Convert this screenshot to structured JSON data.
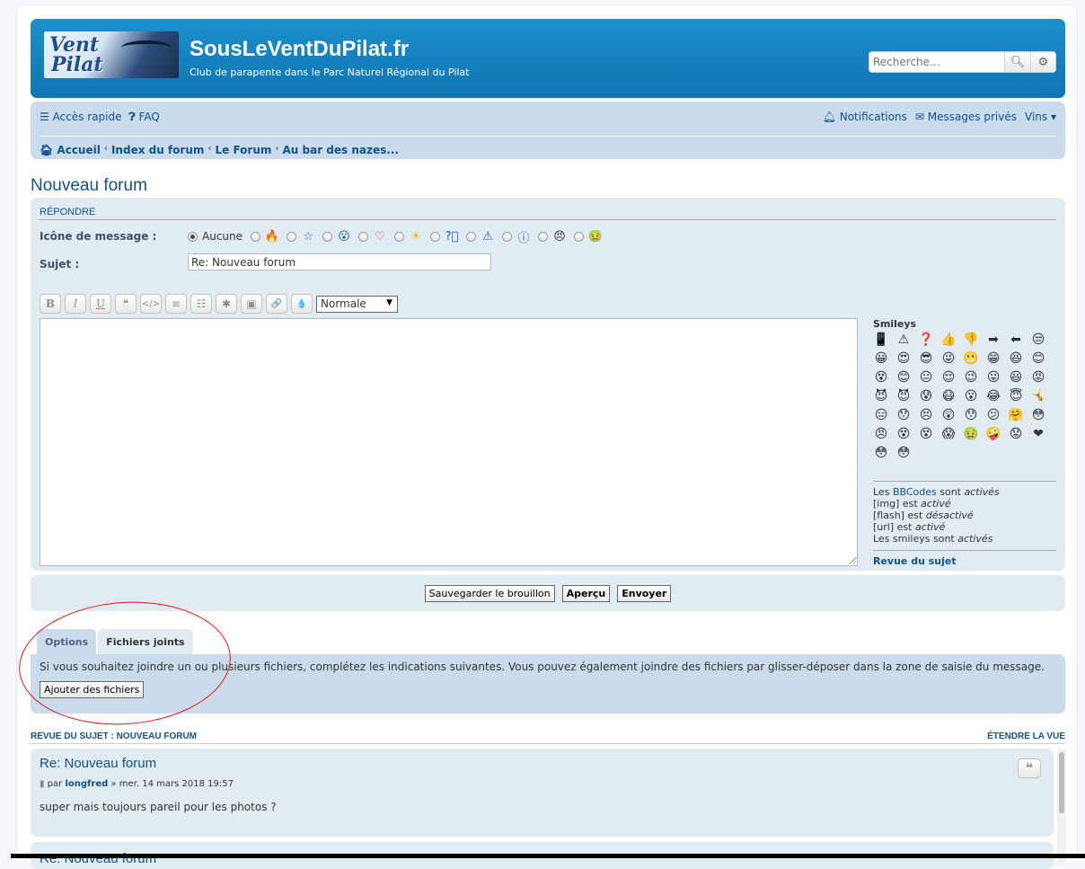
{
  "header": {
    "logo_text_line1": "Vent",
    "logo_text_line2": "Pilat",
    "site_title": "SousLeVentDuPilat.fr",
    "site_description": "Club de parapente dans le Parc Naturel Régional du Pilat",
    "search_placeholder": "Recherche…"
  },
  "navbar": {
    "quick_access": "Accès rapide",
    "faq": "FAQ",
    "notifications": "Notifications",
    "private_messages": "Messages privés",
    "user": "Vins",
    "breadcrumbs": [
      "Accueil",
      "Index du forum",
      "Le Forum",
      "Au bar des nazes..."
    ]
  },
  "page_title": "Nouveau forum",
  "post_form": {
    "heading": "Répondre",
    "icon_label": "Icône de message :",
    "icon_none": "Aucune",
    "icons": [
      "flame-icon",
      "star-icon",
      "surprised-icon",
      "heart-icon",
      "sun-icon",
      "question-icon",
      "warning-icon",
      "info-icon",
      "orange-face-icon",
      "green-face-icon"
    ],
    "subject_label": "Sujet :",
    "subject_value": "Re: Nouveau forum",
    "toolbar": [
      "B",
      "I",
      "U",
      "❝",
      "</>",
      "≡",
      "☷",
      "✱",
      "▣",
      "🔗",
      "💧"
    ],
    "font_size": "Normale",
    "smileys_title": "Smileys",
    "smileys": [
      "📱",
      "⚠",
      "❓",
      "👍",
      "👎",
      "➡",
      "⬅",
      "😒",
      "😀",
      "😍",
      "😎",
      "😜",
      "😬",
      "😁",
      "😆",
      "😊",
      "😵",
      "😊",
      "😐",
      "😌",
      "😉",
      "😛",
      "😃",
      "😡",
      "😈",
      "😈",
      "😰",
      "😷",
      "😮",
      "😂",
      "😇",
      "🤸",
      "😑",
      "😯",
      "😣",
      "😲",
      "😯",
      "😕",
      "🤗",
      "😳",
      "😠",
      "😵",
      "😵",
      "😱",
      "🤢",
      "🤪",
      "😟",
      "❤",
      "😳",
      "😳"
    ],
    "info": {
      "bbcodes_prefix": "Les",
      "bbcodes_link": "BBCodes",
      "bbcodes_suffix": "sont",
      "bbcodes_state": "activés",
      "img_label": "[img] est",
      "img_state": "activé",
      "flash_label": "[flash] est",
      "flash_state": "désactivé",
      "url_label": "[url] est",
      "url_state": "activé",
      "smileys_label": "Les smileys sont",
      "smileys_state": "activés"
    },
    "review_link": "Revue du sujet"
  },
  "submit": {
    "save_draft": "Sauvegarder le brouillon",
    "preview": "Aperçu",
    "send": "Envoyer"
  },
  "tabs": {
    "options": "Options",
    "attachments": "Fichiers joints"
  },
  "attachments": {
    "text": "Si vous souhaitez joindre un ou plusieurs fichiers, complétez les indications suivantes. Vous pouvez également joindre des fichiers par glisser-déposer dans la zone de saisie du message.",
    "add_button": "Ajouter des fichiers"
  },
  "topic_review": {
    "heading": "REVUE DU SUJET : NOUVEAU FORUM",
    "expand": "ÉTENDRE LA VUE",
    "posts": [
      {
        "title": "Re: Nouveau forum",
        "by": "par",
        "author": "longfred",
        "date": "» mer. 14 mars 2018 19:57",
        "body": "super mais toujours pareil pour les photos ?"
      },
      {
        "title": "Re: Nouveau forum"
      }
    ]
  }
}
